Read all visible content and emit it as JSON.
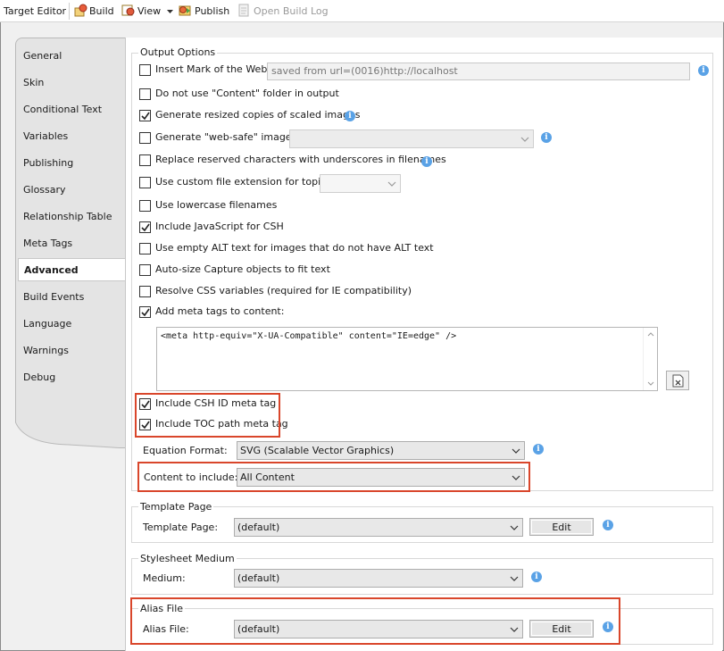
{
  "toolbar": {
    "title": "Target Editor",
    "build": "Build",
    "view": "View",
    "publish": "Publish",
    "open_build_log": "Open Build Log"
  },
  "tabs": [
    {
      "label": "General"
    },
    {
      "label": "Skin"
    },
    {
      "label": "Conditional Text"
    },
    {
      "label": "Variables"
    },
    {
      "label": "Publishing"
    },
    {
      "label": "Glossary"
    },
    {
      "label": "Relationship Table"
    },
    {
      "label": "Meta Tags"
    },
    {
      "label": "Advanced"
    },
    {
      "label": "Build Events"
    },
    {
      "label": "Language"
    },
    {
      "label": "Warnings"
    },
    {
      "label": "Debug"
    }
  ],
  "active_tab": "Advanced",
  "output_options": {
    "title": "Output Options",
    "mark_of_web": {
      "label": "Insert Mark of the Web",
      "checked": false,
      "value": "saved from url=(0016)http://localhost"
    },
    "no_content_folder": {
      "label": "Do not use \"Content\" folder in output",
      "checked": false
    },
    "resized_copies": {
      "label": "Generate resized copies of scaled images",
      "checked": true
    },
    "web_safe": {
      "label": "Generate \"web-safe\" images",
      "checked": false,
      "value": ""
    },
    "replace_reserved": {
      "label": "Replace reserved characters with underscores in filenames",
      "checked": false
    },
    "custom_extension": {
      "label": "Use custom file extension for topics",
      "checked": false,
      "value": ""
    },
    "lowercase": {
      "label": "Use lowercase filenames",
      "checked": false
    },
    "javascript_csh": {
      "label": "Include JavaScript for CSH",
      "checked": true
    },
    "empty_alt": {
      "label": "Use empty ALT text for images that do not have ALT text",
      "checked": false
    },
    "autosize_capture": {
      "label": "Auto-size Capture objects to fit text",
      "checked": false
    },
    "resolve_css": {
      "label": "Resolve CSS variables (required for IE compatibility)",
      "checked": false
    },
    "add_meta": {
      "label": "Add meta tags to content:",
      "checked": true
    },
    "meta_text": "<meta http-equiv=\"X-UA-Compatible\" content=\"IE=edge\" />",
    "csh_id_meta": {
      "label": "Include CSH ID meta tag",
      "checked": true
    },
    "toc_path_meta": {
      "label": "Include TOC path meta tag",
      "checked": true
    },
    "equation_format": {
      "label": "Equation Format:",
      "value": "SVG (Scalable Vector Graphics)"
    },
    "content_include": {
      "label": "Content to include:",
      "value": "All Content"
    }
  },
  "template_page": {
    "title": "Template Page",
    "label": "Template Page:",
    "value": "(default)",
    "edit": "Edit"
  },
  "stylesheet_medium": {
    "title": "Stylesheet Medium",
    "label": "Medium:",
    "value": "(default)"
  },
  "alias_file": {
    "title": "Alias File",
    "label": "Alias File:",
    "value": "(default)",
    "edit": "Edit"
  },
  "colors": {
    "highlight": "#d9462b",
    "info": "#5aa2e6"
  }
}
